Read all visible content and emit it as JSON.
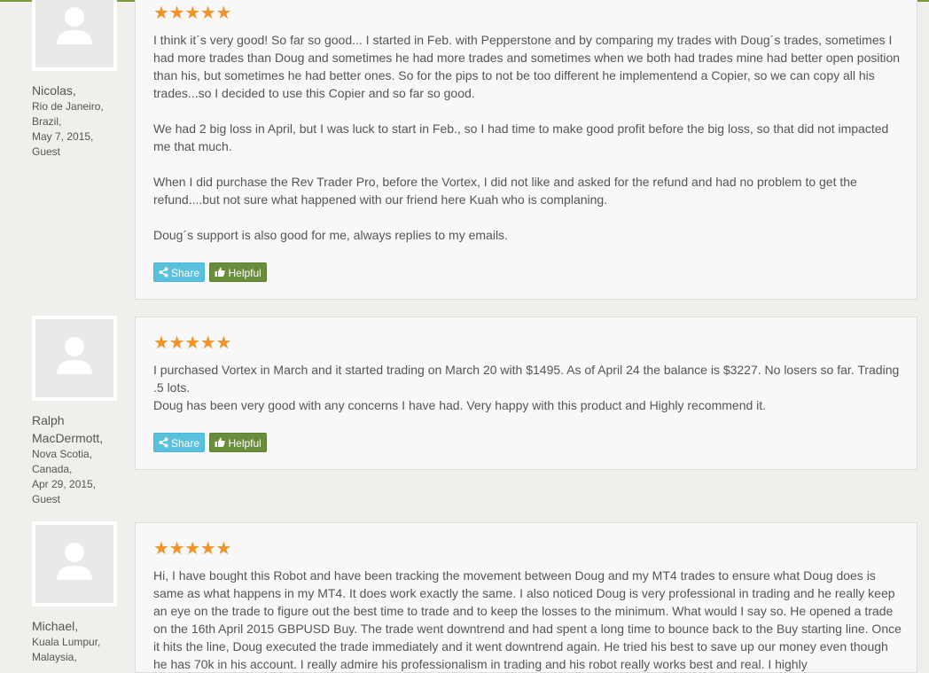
{
  "rating_star": "★",
  "colors": {
    "star": "#f0932b",
    "share": "#5bc0de",
    "helpful": "#6a8d3c",
    "accent_line": "#7a9a3a"
  },
  "reviews": [
    {
      "author": {
        "name": "Nicolas,",
        "city": "Rio de Janeiro,",
        "country": "Brazil,",
        "date": "May 7, 2015,",
        "role": "Guest"
      },
      "rating": 5,
      "paragraphs": [
        "I think it´s very good! So far so good... I started in Feb. with Pepperstone and by comparing my trades with Doug´s trades, sometimes I had more trades than Doug and sometimes he had more trades and sometimes when we both had trades mine had better open position than his, but sometimes he had better ones. So for the pips to not be too different he implementend a Copier, so we can copy all his trades...so I decided to use this Copier and so far so good.",
        "We had 2 big loss in April, but I was luck to start in Feb., so I had time to make good profit before the big loss, so that did not impacted me that much.",
        "When I did purchase the Rev Trader Pro, before the Vortex, I did not like and asked for the refund and had no problem to get the refund....but not sure what happened with our friend here Kuah who is complaning.",
        "Doug´s support is also good for me, always replies to my emails."
      ],
      "share_label": "Share",
      "helpful_label": "Helpful"
    },
    {
      "author": {
        "name_line1": "Ralph",
        "name_line2": "MacDermott,",
        "city": "Nova Scotia,",
        "country": "Canada,",
        "date": "Apr 29, 2015,",
        "role": "Guest"
      },
      "rating": 5,
      "line1": "I purchased Vortex in March and it started trading on March 20 with $1495. As of April 24 the balance is $3227. No losers so far. Trading .5 lots.",
      "line2": "Doug has been very good with any concerns I have had. Very happy with this product and Highly recommend it.",
      "share_label": "Share",
      "helpful_label": "Helpful"
    },
    {
      "author": {
        "name": "Michael,",
        "city": "Kuala Lumpur,",
        "country": "Malaysia,"
      },
      "rating": 5,
      "paragraph": "Hi, I have bought this Robot and have been tracking the movement between Doug and my MT4 trades to ensure what Doug does is same as what happens in my MT4. It does work exactly the same. I also noticed Doug is very professional in trading and he really keep an eye on the trade to figure out the best time to trade and to keep the losses to the minimum. What would I say so. He opened a trade on the 16th April 2015 GBPUSD Buy. The trade went downtrend and had spent a long time to bounce back to the Buy starting line. Once it hits the line, Doug executed the trade immediately and it went downtrend again. He tried his best to save up our money even though he has 70k in his account. I really admire his professionalism in trading and his robot really works best and real. I highly"
    }
  ]
}
